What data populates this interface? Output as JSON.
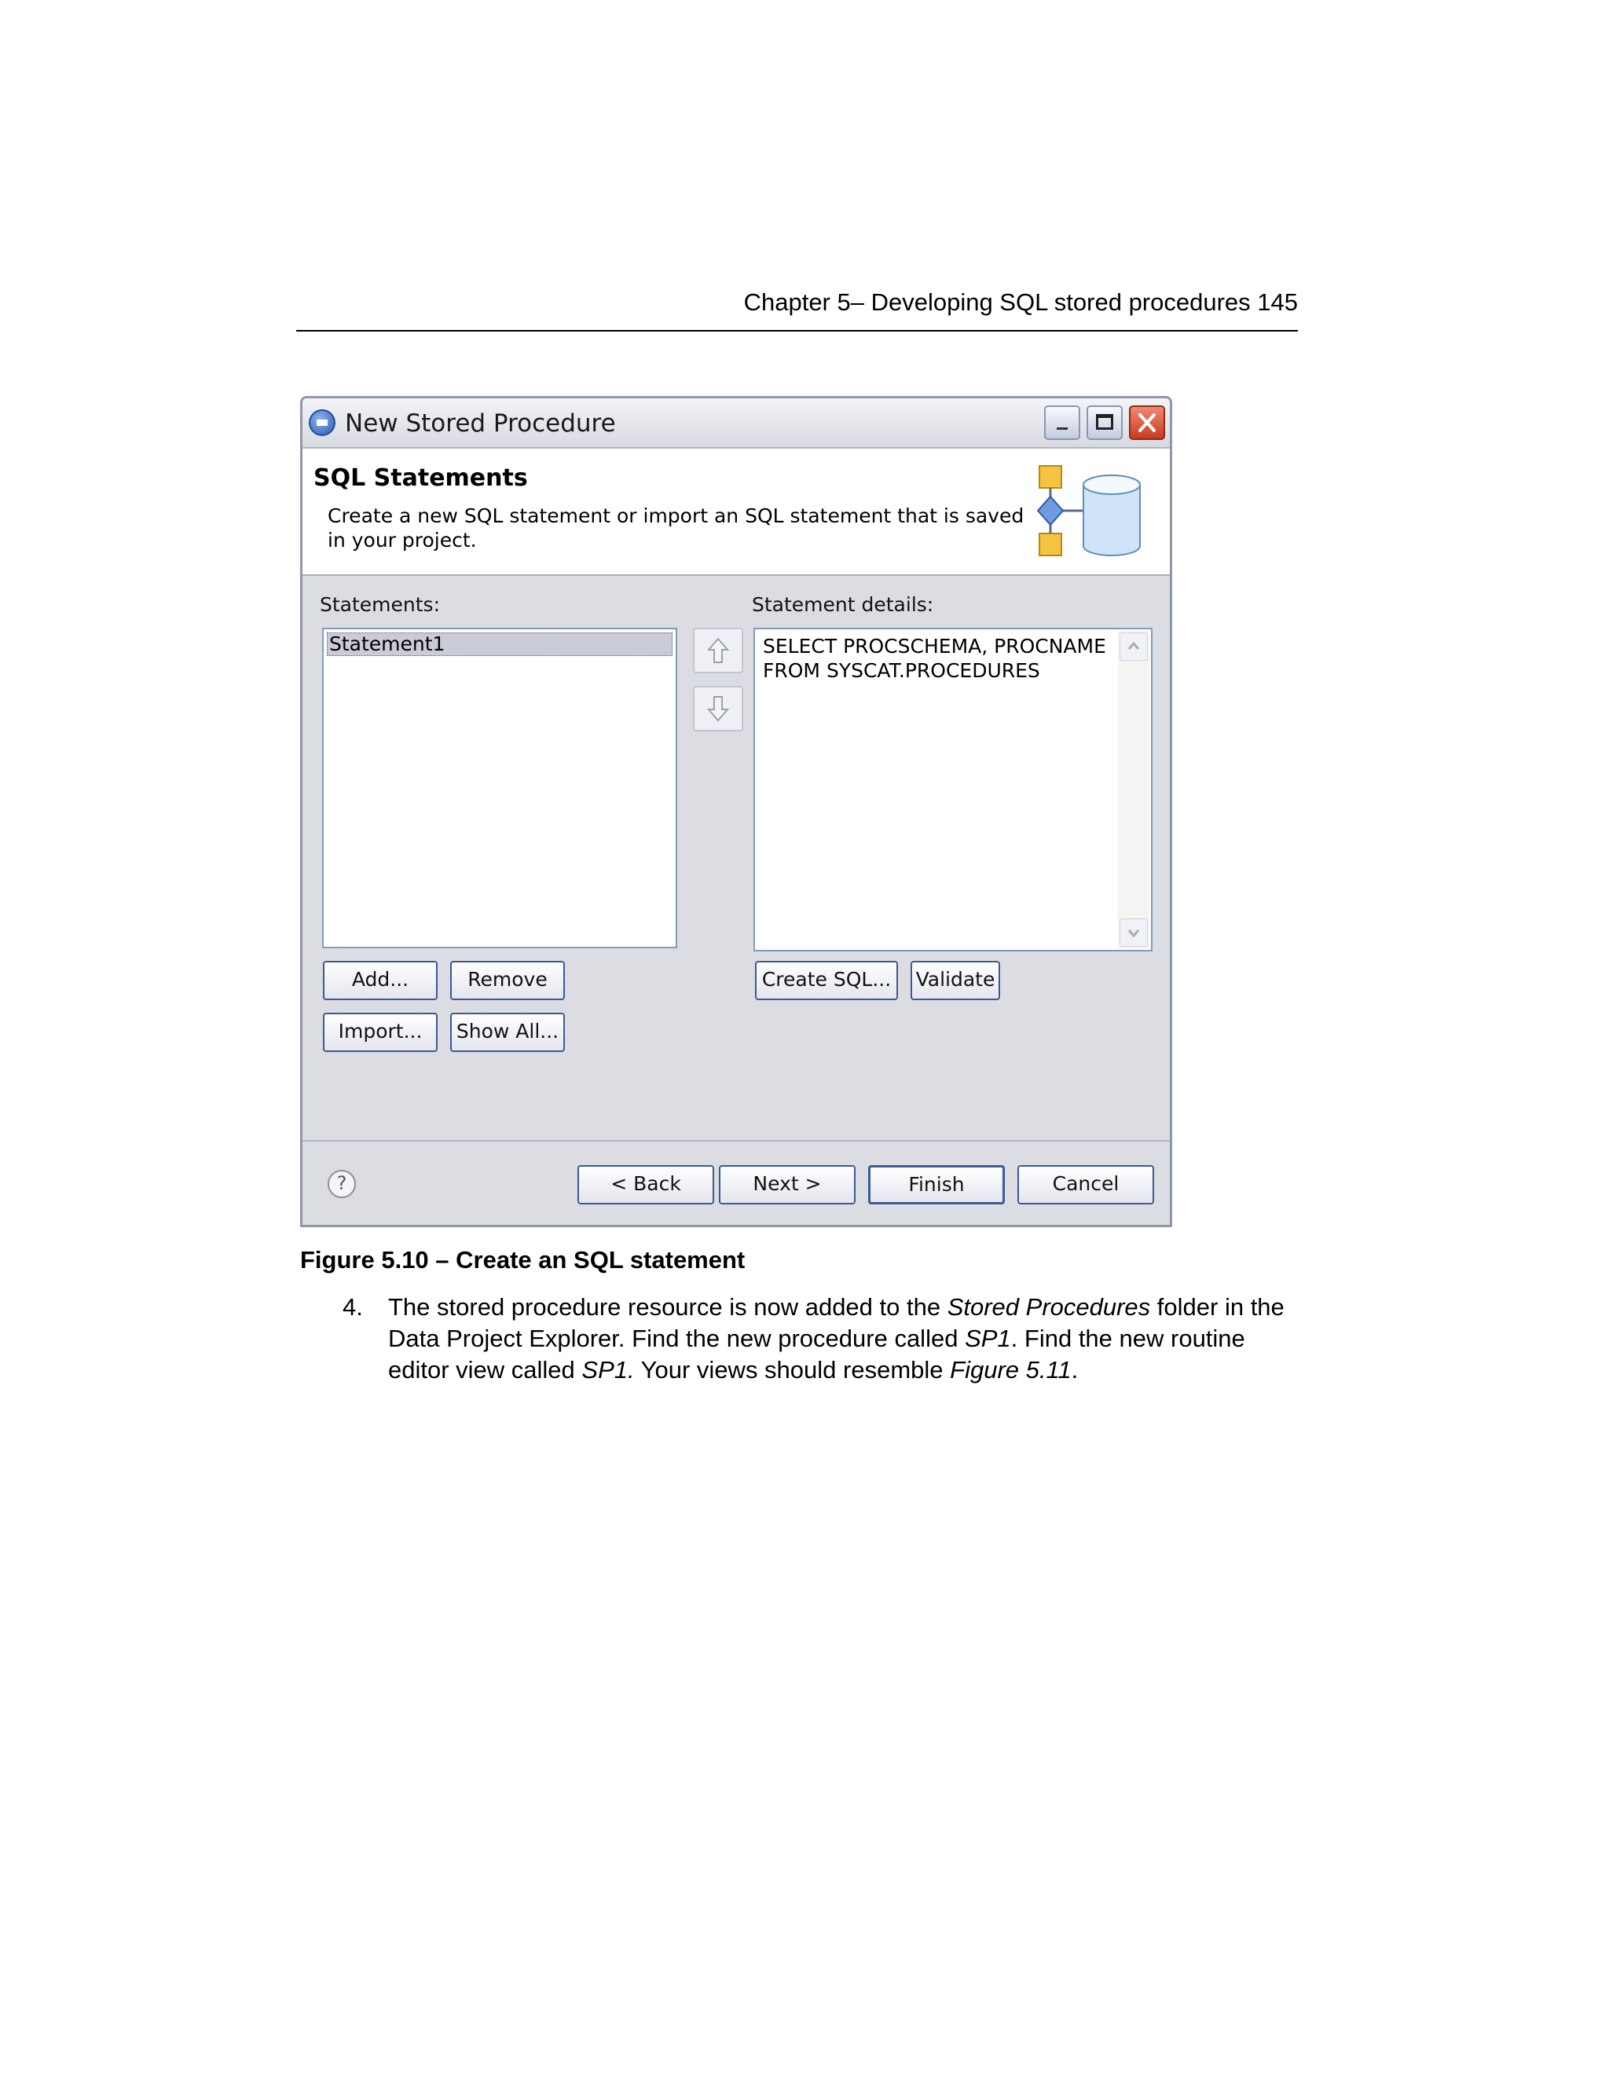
{
  "page_header": "Chapter 5– Developing SQL stored procedures 145",
  "dialog": {
    "title": "New Stored Procedure",
    "banner": {
      "title": "SQL Statements",
      "description": "Create a new SQL statement or import an SQL statement that is saved in your project."
    },
    "statements_label": "Statements:",
    "statements": [
      "Statement1"
    ],
    "details_label": "Statement details:",
    "details_lines": [
      "SELECT PROCSCHEMA, PROCNAME",
      "FROM SYSCAT.PROCEDURES"
    ],
    "buttons": {
      "add": "Add...",
      "remove": "Remove",
      "import": "Import...",
      "show_all": "Show All...",
      "create_sql": "Create SQL...",
      "validate": "Validate",
      "back": "< Back",
      "next": "Next >",
      "finish": "Finish",
      "cancel": "Cancel"
    },
    "help_glyph": "?"
  },
  "caption": "Figure 5.10 – Create an SQL statement",
  "step": {
    "number": "4.",
    "text_1": "The stored procedure resource is now added to the ",
    "em_1": "Stored Procedures",
    "text_2": " folder in the Data Project Explorer.  Find the new procedure called ",
    "em_2": "SP1",
    "text_3": ". Find the new routine editor view called ",
    "em_3": "SP1.",
    "text_4": " Your views should resemble ",
    "em_4": "Figure 5.11",
    "text_5": "."
  },
  "colors": {
    "dialog_bg": "#dcdde3",
    "button_border": "#3a5a96",
    "selection": "#c9ccd6",
    "close_button": "#c93a1e"
  },
  "icons": [
    "window-icon",
    "minimize-icon",
    "maximize-icon",
    "close-icon",
    "database-wizard-icon",
    "move-up-icon",
    "move-down-icon",
    "scroll-up-icon",
    "scroll-down-icon",
    "help-icon"
  ]
}
